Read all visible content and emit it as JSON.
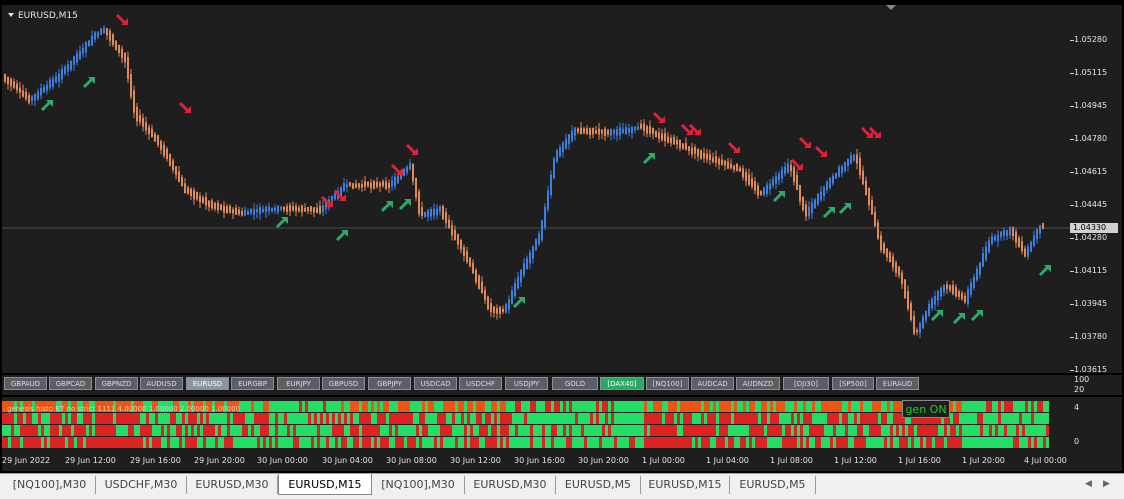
{
  "chart": {
    "title": "EURUSD,M15",
    "price_labels": [
      "1.05280",
      "1.05115",
      "1.04945",
      "1.04780",
      "1.04615",
      "1.04445",
      "1.04280",
      "1.04115",
      "1.03945",
      "1.03780",
      "1.03615"
    ],
    "current_price": "1.04330",
    "time_labels": [
      "29 Jun 2022",
      "29 Jun 12:00",
      "29 Jun 16:00",
      "29 Jun 20:00",
      "30 Jun 00:00",
      "30 Jun 04:00",
      "30 Jun 08:00",
      "30 Jun 12:00",
      "30 Jun 16:00",
      "30 Jun 20:00",
      "1 Jul 00:00",
      "1 Jul 04:00",
      "1 Jul 08:00",
      "1 Jul 12:00",
      "1 Jul 16:00",
      "1 Jul 20:00",
      "4 Jul 00:00"
    ],
    "colors": {
      "bull": "#3c7fe0",
      "bear": "#e08a55",
      "buy_arrow": "#2eaa6a",
      "sell_arrow": "#e0203c",
      "background": "#1e1e1e"
    }
  },
  "symbol_buttons": [
    {
      "label": "GBPAUD",
      "state": "normal"
    },
    {
      "label": "GBPCAD",
      "state": "normal"
    },
    {
      "label": "GBPNZD",
      "state": "normal"
    },
    {
      "label": "AUDUSD",
      "state": "normal"
    },
    {
      "label": "EURUSD",
      "state": "selected"
    },
    {
      "label": "EURGBP",
      "state": "normal"
    },
    {
      "label": "EURJPY",
      "state": "normal"
    },
    {
      "label": "GBPUSD",
      "state": "normal"
    },
    {
      "label": "GBPJPY",
      "state": "normal"
    },
    {
      "label": "USDCAD",
      "state": "normal"
    },
    {
      "label": "USDCHF",
      "state": "normal"
    },
    {
      "label": "USDJPY",
      "state": "normal"
    },
    {
      "label": "GOLD",
      "state": "normal"
    },
    {
      "label": "[DAX40]",
      "state": "active"
    },
    {
      "label": "[NQ100]",
      "state": "normal"
    },
    {
      "label": "AUDCAD",
      "state": "normal"
    },
    {
      "label": "AUDNZD",
      "state": "normal"
    },
    {
      "label": "[DJI30]",
      "state": "normal"
    },
    {
      "label": "[SP500]",
      "state": "normal"
    },
    {
      "label": "EURAUD",
      "state": "normal"
    }
  ],
  "sub_axis": {
    "top": "100",
    "bottom": "20"
  },
  "indicator": {
    "label": "genesis histo BT no strict 1111 4.00000 1.00000 2.00000 1.00000",
    "badge": "gen ON",
    "axis_top": "4",
    "axis_bottom": "0",
    "colors": {
      "up": "#22dd66",
      "down": "#dd2222",
      "orange": "#ee5511"
    }
  },
  "tabs": [
    {
      "label": "[NQ100],M30",
      "active": false
    },
    {
      "label": "USDCHF,M30",
      "active": false
    },
    {
      "label": "EURUSD,M30",
      "active": false
    },
    {
      "label": "EURUSD,M15",
      "active": true
    },
    {
      "label": "[NQ100],M30",
      "active": false
    },
    {
      "label": "EURUSD,M30",
      "active": false
    },
    {
      "label": "EURUSD,M5",
      "active": false
    },
    {
      "label": "EURUSD,M15",
      "active": false
    },
    {
      "label": "EURUSD,M5",
      "active": false
    }
  ]
}
